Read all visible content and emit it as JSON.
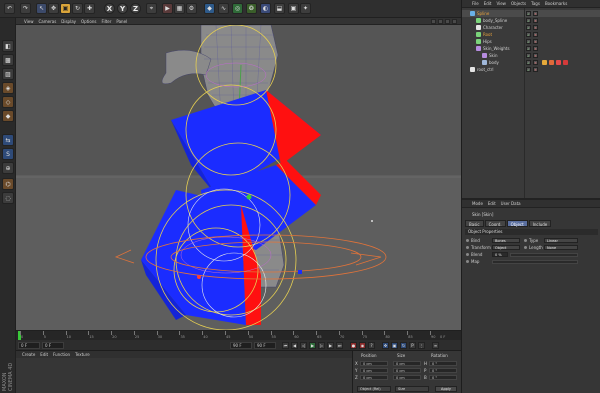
{
  "viewport_menu": [
    "View",
    "Cameras",
    "Display",
    "Options",
    "Filter",
    "Panel"
  ],
  "toolbar": {
    "axis_x": "X",
    "axis_y": "Y",
    "axis_z": "Z"
  },
  "objects_menu": [
    "File",
    "Edit",
    "View",
    "Objects",
    "Tags",
    "Bookmarks"
  ],
  "objects": [
    {
      "name": "Spline",
      "icon_color": "#6ab0e6",
      "indent": 0,
      "highlight": true
    },
    {
      "name": "body_Spline",
      "icon_color": "#7ad47a",
      "indent": 1,
      "highlight": false
    },
    {
      "name": "Character",
      "icon_color": "#e5e5e5",
      "indent": 1,
      "highlight": false
    },
    {
      "name": "Root",
      "icon_color": "#7ad47a",
      "indent": 1,
      "highlight": true
    },
    {
      "name": "Hips",
      "icon_color": "#7ad47a",
      "indent": 1,
      "highlight": false
    },
    {
      "name": "Skin_Weights",
      "icon_color": "#b68ce0",
      "indent": 1,
      "highlight": false
    },
    {
      "name": "Skin",
      "icon_color": "#b68ce0",
      "indent": 2,
      "highlight": false
    },
    {
      "name": "body",
      "icon_color": "#9fb7d9",
      "indent": 2,
      "highlight": false
    },
    {
      "name": "root_ctrl",
      "icon_color": "#e5e5e5",
      "indent": 0,
      "highlight": false
    }
  ],
  "attributes": {
    "menu": [
      "Mode",
      "Edit",
      "User Data"
    ],
    "title": "Skin [Skin]",
    "tabs": [
      "Basic",
      "Coord.",
      "Object",
      "Include"
    ],
    "active_tab": "Object",
    "section": "Object Properties",
    "rows": [
      {
        "label": "Bind",
        "value": "Bones",
        "label2": "Type",
        "value2": "Linear"
      },
      {
        "label": "Transform",
        "value": "Object",
        "label2": "Length",
        "value2": "None"
      },
      {
        "label": "Blend",
        "value": "0 %"
      },
      {
        "label": "Map",
        "value": ""
      }
    ]
  },
  "timeline": {
    "ticks": [
      "0",
      "5",
      "10",
      "15",
      "20",
      "25",
      "30",
      "35",
      "40",
      "45",
      "50",
      "55",
      "60",
      "65",
      "70",
      "75",
      "80",
      "85",
      "90"
    ],
    "end_label": "0 F",
    "start_field": "0 F",
    "min_field": "0 F",
    "max_field": "90 F",
    "end_field": "90 F"
  },
  "materials_menu": [
    "Create",
    "Edit",
    "Function",
    "Texture"
  ],
  "coordinates": {
    "headers": [
      "Position",
      "Size",
      "Rotation"
    ],
    "rows": [
      {
        "axis": "X",
        "pos": "0 cm",
        "size": "0 cm",
        "rot_axis": "H",
        "rot": "0 °"
      },
      {
        "axis": "Y",
        "pos": "0 cm",
        "size": "0 cm",
        "rot_axis": "P",
        "rot": "0 °"
      },
      {
        "axis": "Z",
        "pos": "0 cm",
        "size": "0 cm",
        "rot_axis": "B",
        "rot": "0 °"
      }
    ],
    "mode_dropdown": "Object (Rel)",
    "size_dropdown": "Size",
    "apply_label": "Apply"
  },
  "brand": "MAXON CINEMA 4D",
  "colors": {
    "viewport_bg": "#5a5a5a",
    "plane_blue": "#1b2cff",
    "plane_red": "#ff1010",
    "ring_yellow": "#e6cf52",
    "ring_orange": "#e0733a",
    "accent_playhead": "#3ac93a"
  }
}
